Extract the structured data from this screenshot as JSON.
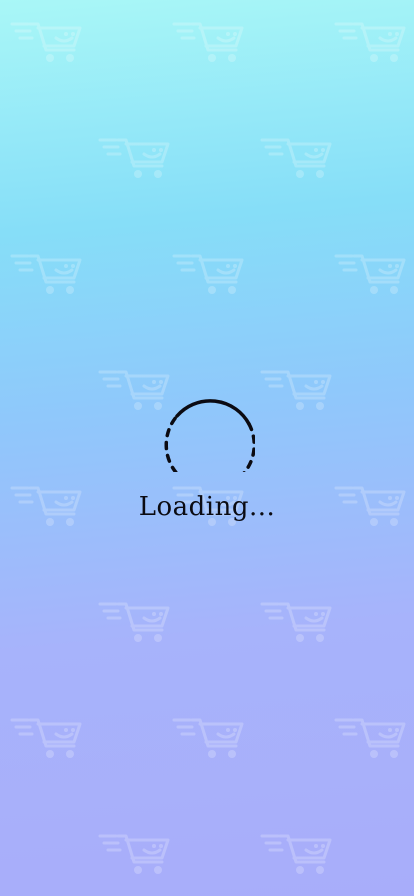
{
  "screen": {
    "background_gradient": [
      "#a9f7f7",
      "#86def8",
      "#8fc8fb",
      "#a7b3fb",
      "#a8adfa"
    ],
    "pattern_icon": "shopping-cart-smile-icon",
    "pattern_color": "#ffffff"
  },
  "loader": {
    "spinner_icon": "dashed-circle-spinner-icon",
    "spinner_color": "#0b0b12",
    "label": "Loading..."
  }
}
